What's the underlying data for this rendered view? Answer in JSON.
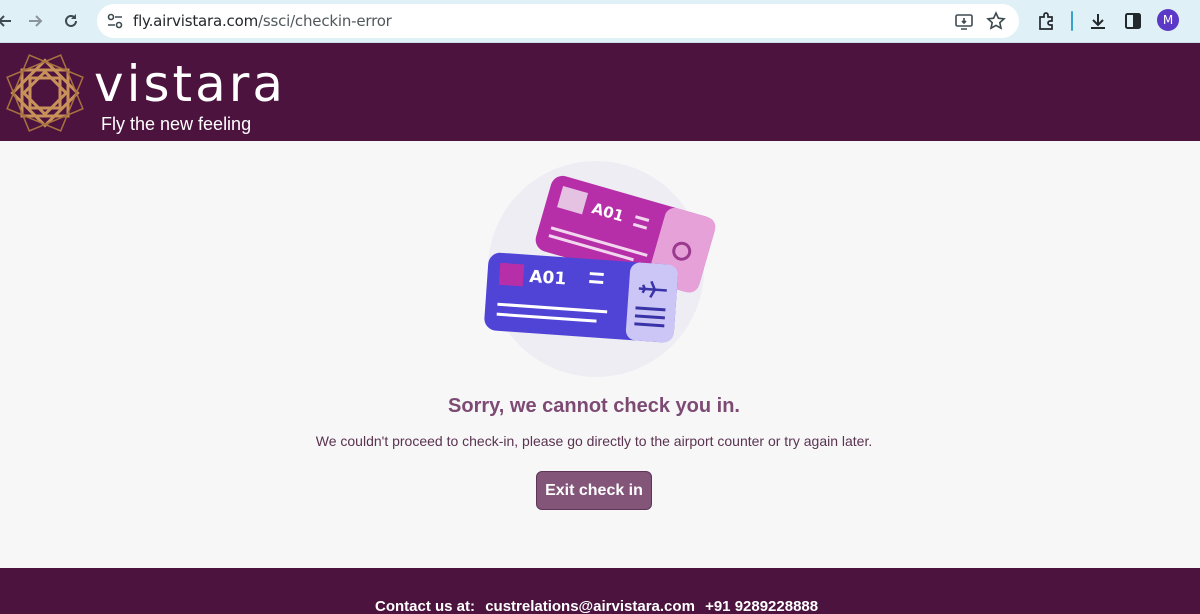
{
  "browser": {
    "url_host": "fly.airvistara.com",
    "url_path": "/ssci/checkin-error",
    "profile_initial": "M",
    "icons": [
      "back-icon",
      "forward-icon",
      "reload-icon",
      "site-settings-icon",
      "install-app-icon",
      "bookmark-star-icon",
      "extensions-icon",
      "download-icon",
      "side-panel-icon"
    ]
  },
  "header": {
    "brand": "vistara",
    "tagline": "Fly the new feeling",
    "colors": {
      "background": "#4b133e",
      "logo_gold": "#c8915a"
    }
  },
  "main": {
    "boarding_pass_front_seat": "A01",
    "boarding_pass_back_seat": "A01",
    "title": "Sorry, we cannot check you in.",
    "message": "We couldn't proceed to check-in, please go directly to the airport counter or try again later.",
    "exit_button": "Exit check in",
    "colors": {
      "title": "#7d4a73",
      "button": "#825579"
    }
  },
  "footer": {
    "contact_label": "Contact us at:",
    "email": "custrelations@airvistara.com",
    "phone": "+91 9289228888"
  }
}
